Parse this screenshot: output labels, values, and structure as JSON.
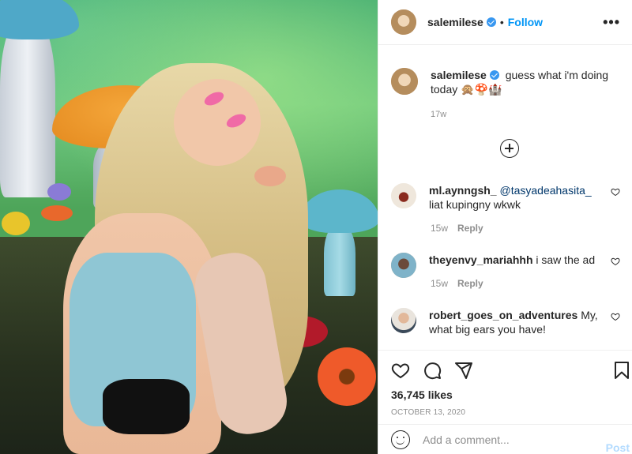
{
  "post": {
    "username": "salemilese",
    "follow_label": "Follow",
    "more_label": "•••",
    "separator": "•"
  },
  "caption": {
    "username": "salemilese",
    "text": "guess what i'm doing today 🙊🍄🏰",
    "time": "17w"
  },
  "comments": [
    {
      "username": "ml.aynngsh_",
      "mention": "@tasyadeahasita_",
      "text": "liat kupingny wkwk",
      "time": "15w",
      "reply_label": "Reply"
    },
    {
      "username": "theyenvy_mariahhh",
      "text": "i saw the ad",
      "time": "15w",
      "reply_label": "Reply"
    },
    {
      "username": "robert_goes_on_adventures",
      "text": "My, what big ears you have!"
    }
  ],
  "likes": "36,745 likes",
  "date": "OCTOBER 13, 2020",
  "add_comment": {
    "placeholder": "Add a comment...",
    "post_label": "Post"
  },
  "colors": {
    "link_blue": "#0095f6",
    "verified_blue": "#3897f0",
    "muted": "#8e8e8e",
    "post_disabled": "#b3dbff"
  },
  "icons": {
    "header_more": "more-horizontal-icon",
    "verified": "verified-badge-icon",
    "load_more": "plus-circle-icon",
    "comment_like": "heart-outline-icon",
    "like": "heart-icon",
    "comment": "comment-bubble-icon",
    "share": "paper-plane-icon",
    "save": "bookmark-icon",
    "emoji": "emoji-smile-icon"
  }
}
